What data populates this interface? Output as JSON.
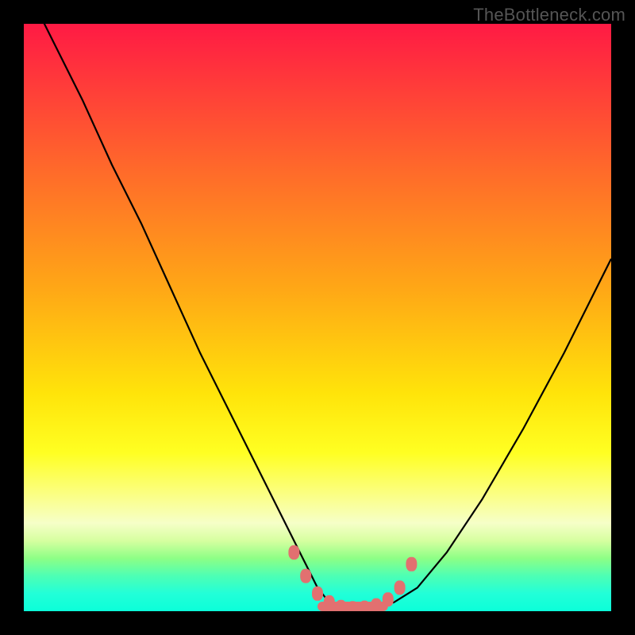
{
  "watermark": "TheBottleneck.com",
  "colors": {
    "frame": "#000000",
    "curve_stroke": "#000000",
    "marker_fill": "#e27070",
    "gradient_top": "#ff1a44",
    "gradient_bottom": "#0bffd9"
  },
  "chart_data": {
    "type": "line",
    "title": "",
    "xlabel": "",
    "ylabel": "",
    "xlim": [
      0,
      100
    ],
    "ylim": [
      0,
      100
    ],
    "series": [
      {
        "name": "bottleneck-curve",
        "x": [
          0,
          5,
          10,
          15,
          20,
          25,
          30,
          35,
          40,
          45,
          48,
          50,
          52,
          55,
          58,
          60,
          63,
          67,
          72,
          78,
          85,
          92,
          100
        ],
        "y": [
          107,
          97,
          87,
          76,
          66,
          55,
          44,
          34,
          24,
          14,
          8,
          4,
          1.5,
          0.6,
          0.5,
          0.6,
          1.5,
          4,
          10,
          19,
          31,
          44,
          60
        ]
      }
    ],
    "markers": {
      "name": "highlight-points",
      "x": [
        46,
        48,
        50,
        52,
        54,
        56,
        58,
        60,
        62,
        64,
        66
      ],
      "y": [
        10,
        6,
        3,
        1.5,
        0.7,
        0.5,
        0.6,
        1,
        2,
        4,
        8
      ]
    }
  }
}
